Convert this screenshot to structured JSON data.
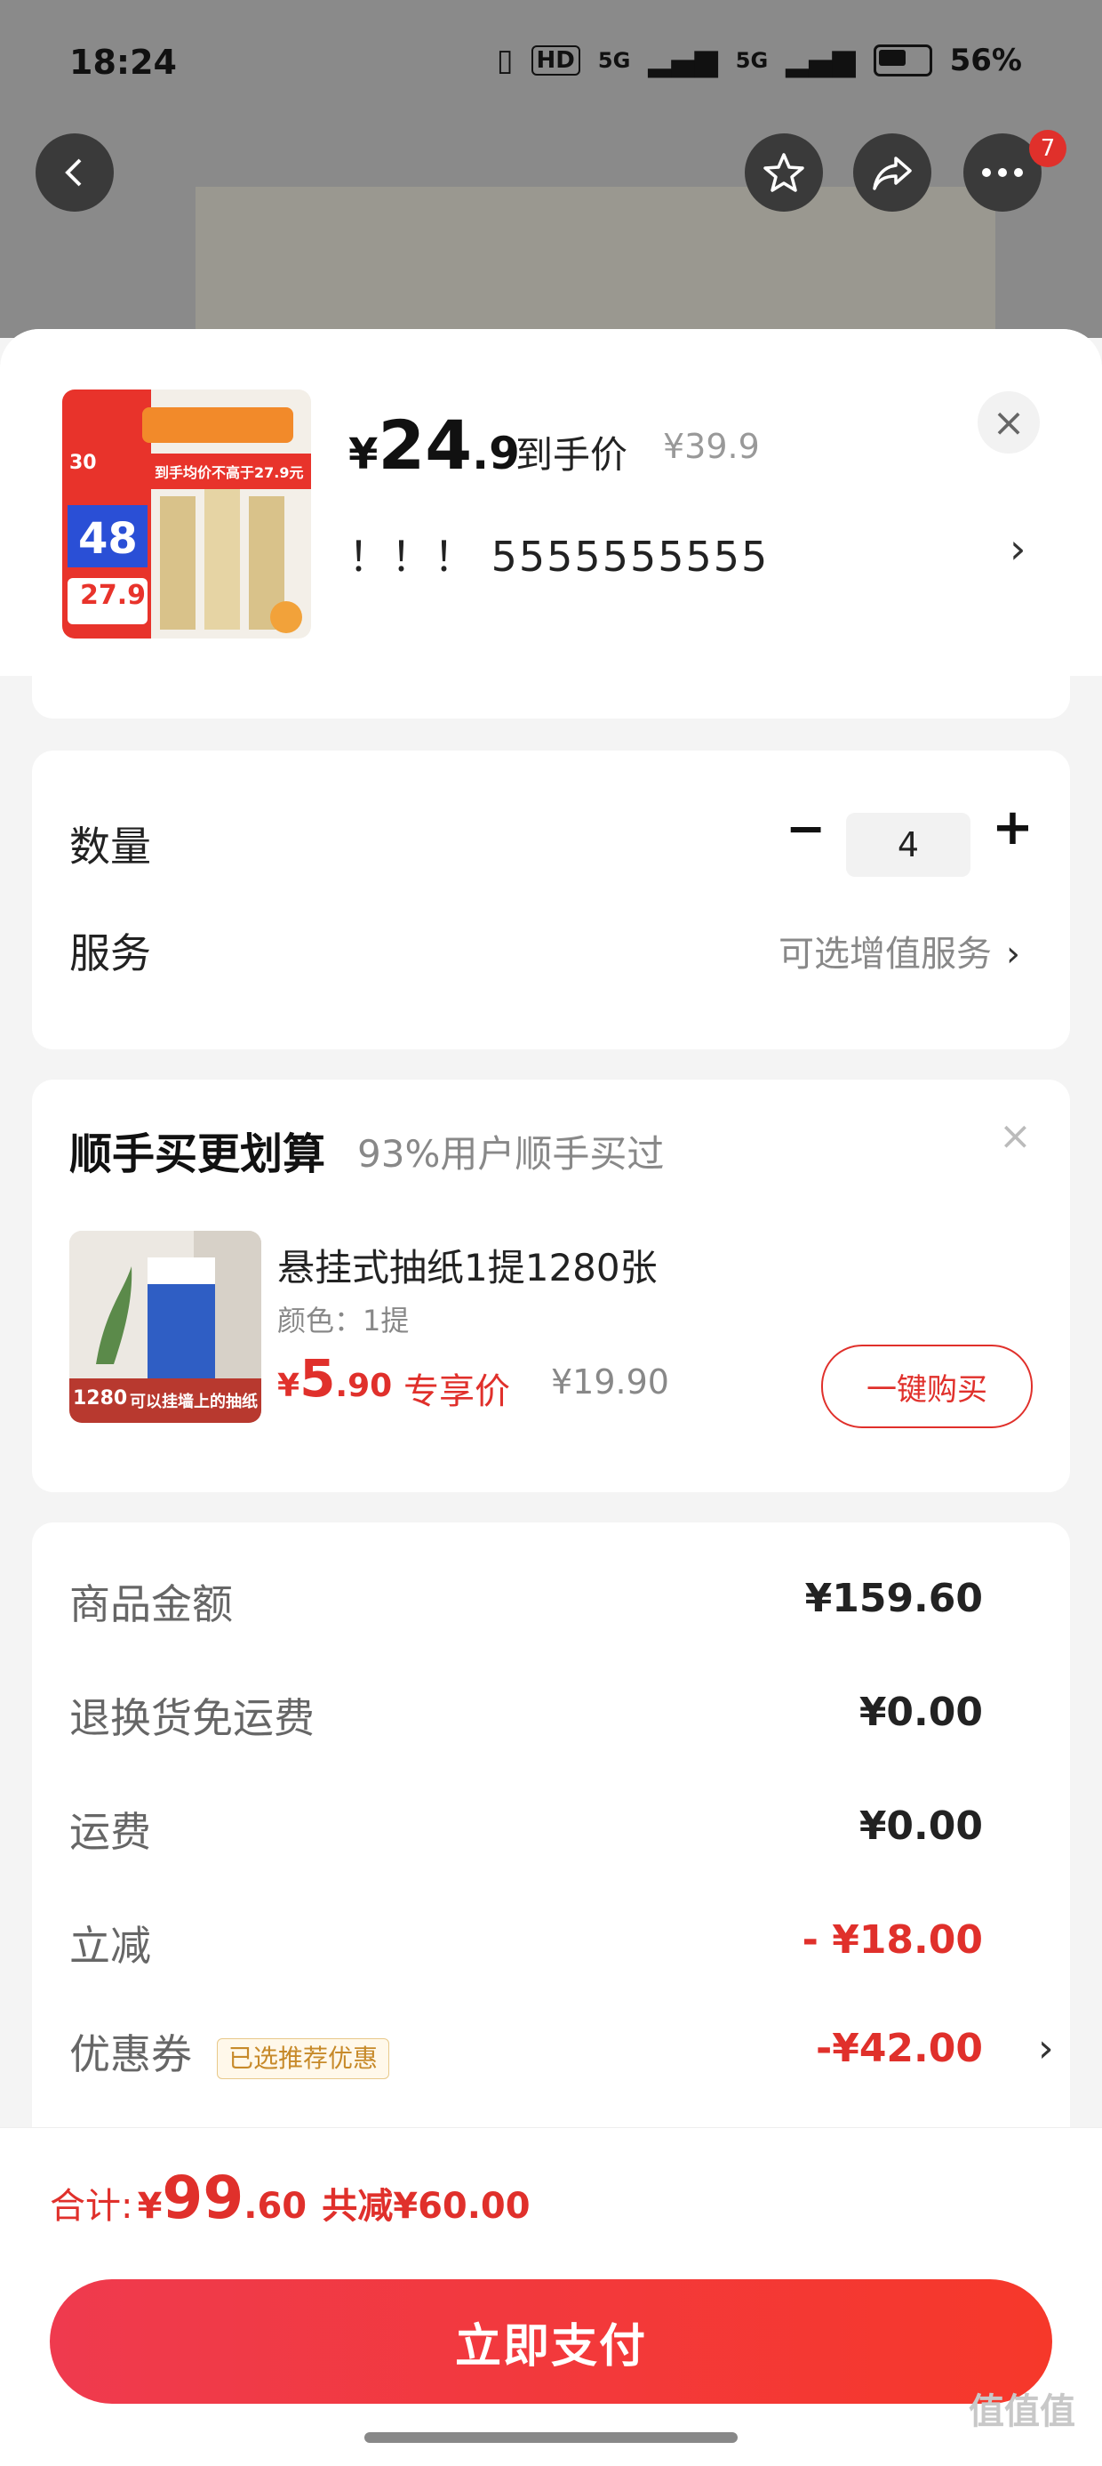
{
  "status": {
    "time": "18:24",
    "network1": "5G",
    "network2": "5G",
    "battery": "56%"
  },
  "nav": {
    "badge_count": "7"
  },
  "product": {
    "price_yen": "¥",
    "price_int": "24",
    "price_dec": ".9",
    "arrive_label": "到手价",
    "orig_price": "¥39.9",
    "spec_text": "！！！  5555555555",
    "spec_arrow": "›",
    "thumb_big": "48",
    "thumb_badge": "30",
    "thumb_price": "27.9",
    "thumb_banner": "到手均价不高于27.9元"
  },
  "options": {
    "qty_label": "数量",
    "qty_minus": "−",
    "qty_value": "4",
    "qty_plus": "+",
    "service_label": "服务",
    "service_value": "可选增值服务",
    "service_arrow": "›"
  },
  "upsell": {
    "title": "顺手买更划算",
    "subtitle": "93%用户顺手买过",
    "close": "×",
    "item_name": "悬挂式抽纸1提1280张",
    "item_color": "颜色：1提",
    "price_yen": "¥",
    "price_int": "5",
    "price_dec": ".90",
    "price_tag": "专享价",
    "orig_price": "¥19.90",
    "buy_label": "一键购买",
    "img_count": "1280",
    "img_caption": "可以挂墙上的抽纸"
  },
  "summary": {
    "rows": [
      {
        "label": "商品金额",
        "value": "¥159.60"
      },
      {
        "label": "退换货免运费",
        "value": "¥0.00"
      },
      {
        "label": "运费",
        "value": "¥0.00"
      },
      {
        "label": "立减",
        "value": "- ¥18.00"
      },
      {
        "label": "优惠券",
        "value": "-¥42.00"
      }
    ],
    "coupon_chip": "已选推荐优惠",
    "coupon_arrow": "›"
  },
  "footer": {
    "total_label": "合计:",
    "total_yen": "¥",
    "total_int": "99",
    "total_dec": ".60",
    "total_saved": "共减¥60.00",
    "pay_label": "立即支付",
    "watermark": "值值值"
  },
  "colors": {
    "accent": "#e0302b",
    "muted": "#888888"
  }
}
